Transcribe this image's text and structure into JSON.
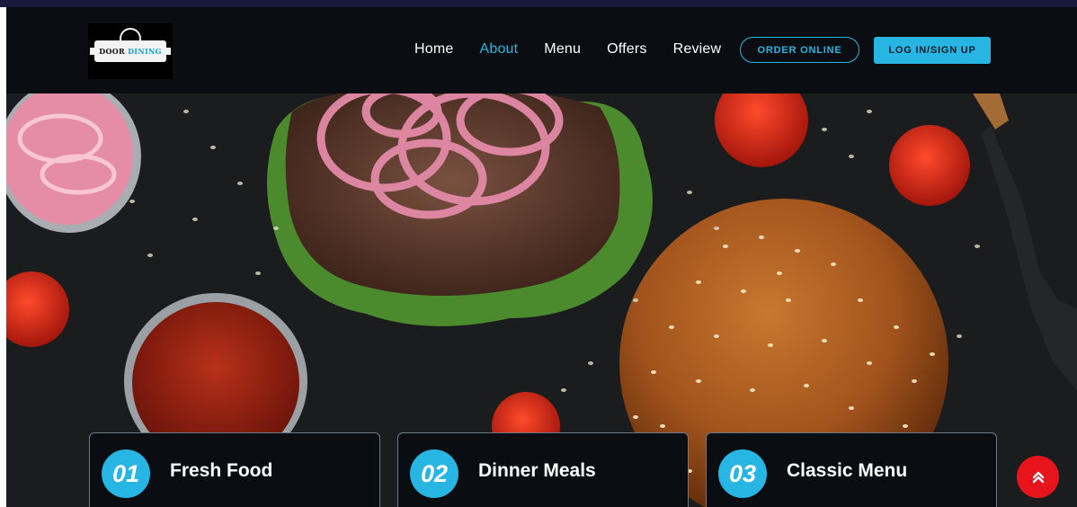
{
  "brand": {
    "line1": "DOOR",
    "line2": "DINING"
  },
  "nav": {
    "items": [
      {
        "label": "Home",
        "active": false
      },
      {
        "label": "About",
        "active": true
      },
      {
        "label": "Menu",
        "active": false
      },
      {
        "label": "Offers",
        "active": false
      },
      {
        "label": "Review",
        "active": false
      }
    ],
    "order_label": "ORDER ONLINE",
    "login_label": "LOG IN/SIGN UP"
  },
  "features": [
    {
      "number": "01",
      "title": "Fresh Food"
    },
    {
      "number": "02",
      "title": "Dinner Meals"
    },
    {
      "number": "03",
      "title": "Classic Menu"
    }
  ],
  "colors": {
    "accent": "#27b6e3",
    "background": "#0a0d12",
    "scroll_button": "#e8141c"
  },
  "icons": {
    "scroll_top": "double-chevron-up-icon",
    "logo": "cloche-icon"
  }
}
